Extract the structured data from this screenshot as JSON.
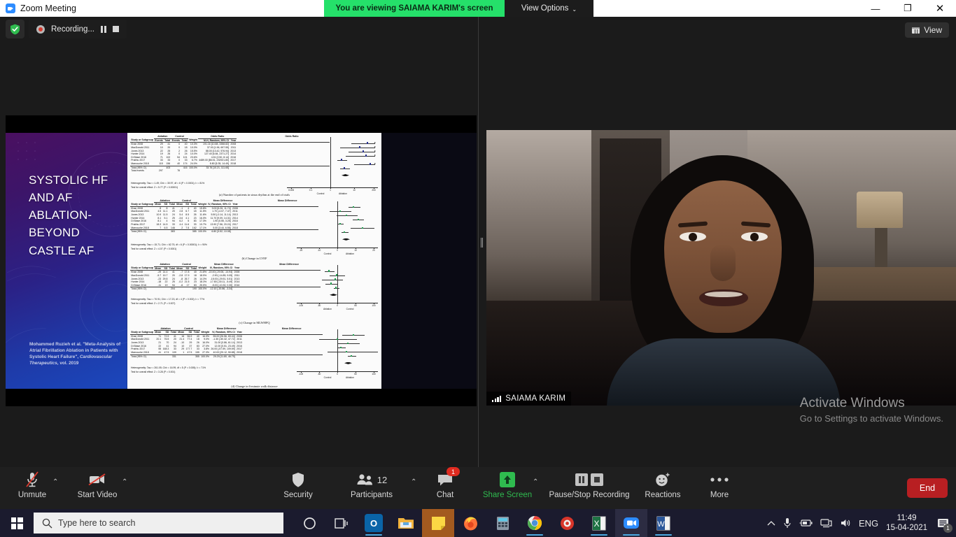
{
  "titlebar": {
    "app_title": "Zoom Meeting",
    "logo_icon": "zoom-logo-icon",
    "share_banner": "You are viewing SAIAMA KARIM's screen",
    "view_options_label": "View Options",
    "view_options_caret": "⌄",
    "minimize": "—",
    "maximize": "❐",
    "close": "✕"
  },
  "recording": {
    "shield_icon": "shield-check-icon",
    "status_text": "Recording...",
    "pause_icon": "pause-icon",
    "stop_icon": "stop-icon"
  },
  "share_pane": {
    "slide": {
      "title": "SYSTOLIC HF AND AF ABLATION- BEYOND CASTLE AF",
      "citation_plain_1": "Mohammed Ruzieh et al. \"Meta-Analysis of Atrial Fibrillation Ablation in Patients with Systolic Heart Failure\", ",
      "citation_italic": "Cardiovascular Therapeutics",
      "citation_plain_2": ", vol. 2019"
    }
  },
  "video_pane": {
    "view_button_label": "View",
    "view_button_icon": "gallery-view-icon",
    "participant_name": "SAIAMA KARIM",
    "signal_icon": "signal-strength-icon"
  },
  "watermark": {
    "line1": "Activate Windows",
    "line2": "Go to Settings to activate Windows."
  },
  "toolbar": {
    "items": [
      {
        "id": "unmute",
        "label": "Unmute",
        "icon": "microphone-muted-icon",
        "caret": "⌃"
      },
      {
        "id": "start-video",
        "label": "Start Video",
        "icon": "video-camera-muted-icon",
        "caret": "⌃"
      },
      {
        "id": "security",
        "label": "Security",
        "icon": "shield-icon"
      },
      {
        "id": "participants",
        "label": "Participants",
        "icon": "people-icon",
        "count": "12",
        "caret": "⌃"
      },
      {
        "id": "chat",
        "label": "Chat",
        "icon": "chat-bubble-icon",
        "badge": "1"
      },
      {
        "id": "share-screen",
        "label": "Share Screen",
        "icon": "share-screen-up-arrow-icon",
        "caret": "⌃"
      },
      {
        "id": "pause-stop-recording",
        "label": "Pause/Stop Recording",
        "icon": "pause-stop-icon"
      },
      {
        "id": "reactions",
        "label": "Reactions",
        "icon": "smiley-reactions-icon"
      },
      {
        "id": "more",
        "label": "More",
        "icon": "ellipsis-icon"
      }
    ],
    "end_label": "End"
  },
  "taskbar": {
    "start_icon": "windows-start-icon",
    "search_placeholder": "Type here to search",
    "search_icon": "search-icon",
    "pinned": [
      {
        "id": "cortana",
        "icon": "cortana-circle-icon",
        "label": "O"
      },
      {
        "id": "task-view",
        "icon": "task-view-icon",
        "label": "目"
      },
      {
        "id": "outlook",
        "icon": "outlook-icon",
        "label": "O"
      },
      {
        "id": "file-explorer",
        "icon": "file-explorer-icon",
        "label": "📁"
      },
      {
        "id": "sticky-notes",
        "icon": "sticky-notes-icon",
        "label": "▧"
      },
      {
        "id": "firefox",
        "icon": "firefox-icon",
        "label": "🦊"
      },
      {
        "id": "calculator",
        "icon": "calculator-icon",
        "label": "▤"
      },
      {
        "id": "chrome",
        "icon": "chrome-icon",
        "label": "◉"
      },
      {
        "id": "app-red",
        "icon": "red-app-icon",
        "label": "◍"
      },
      {
        "id": "excel",
        "icon": "excel-icon",
        "label": "X"
      },
      {
        "id": "zoom",
        "icon": "zoom-icon",
        "label": "▣"
      },
      {
        "id": "word",
        "icon": "word-icon",
        "label": "W"
      }
    ],
    "tray": {
      "chevron_icon": "show-hidden-icons-chevron",
      "mic_icon": "microphone-icon",
      "battery_icon": "battery-icon",
      "network_icon": "network-icon",
      "volume_icon": "volume-icon",
      "language": "ENG",
      "time": "11:49",
      "date": "15-04-2021",
      "notification_icon": "action-center-icon",
      "notification_count": "1"
    }
  },
  "chart_data": [
    {
      "type": "table",
      "id": "forest-a",
      "caption": "(a) Number of patients in sinus rhythm at the end of trials",
      "group_headers": [
        "Ablation",
        "Control",
        "Odds Ratio",
        "Odds Ratio"
      ],
      "columns": [
        "Study or Subgroup",
        "Events",
        "Total",
        "Events",
        "Total",
        "Weight",
        "M-H, Random, 95% CI",
        "Year"
      ],
      "rows": [
        [
          "Khan 2008",
          "29",
          "41",
          "0",
          "40",
          "10.3%",
          "191.16 [10.88, 3358.82]",
          "2008"
        ],
        [
          "MacDonald 2011",
          "10",
          "20",
          "0",
          "18",
          "10.0%",
          "37.00 [1.96, 697.55]",
          "2011"
        ],
        [
          "Jones 2013",
          "22",
          "25",
          "2",
          "26",
          "15.5%",
          "88.00 [13.42, 576.94]",
          "2013"
        ],
        [
          "Hunter 2014",
          "19",
          "26",
          "0",
          "24",
          "10.0%",
          "127.40 [6.84, 2371.27]",
          "2014"
        ],
        [
          "Di Biase 2016",
          "71",
          "102",
          "54",
          "101",
          "23.6%",
          "4.51 [2.50, 8.14]",
          "2016"
        ],
        [
          "Prabhu 2017",
          "33",
          "33",
          "0",
          "33",
          "6.7%",
          "4489.00 [86.51, 232921.80]",
          "2017"
        ],
        [
          "Marrouche 2018",
          "115",
          "156",
          "40",
          "174",
          "24.0%",
          "8.80 [5.35, 14.49]",
          "2018"
        ]
      ],
      "total_row": [
        "Total (95% CI)",
        "",
        "403",
        "",
        "416",
        "100.0%",
        "33.76 [10.21, 111.65]",
        ""
      ],
      "total_events": [
        "Total events",
        "297",
        "",
        "76",
        "",
        "",
        "",
        ""
      ],
      "heterogeneity": "Heterogeneity: Tau² = 1.49; Chi² = 30.97, df = 6 (P < 0.0001); I² = 81%",
      "overall_effect": "Test for overall effect: Z = 5.77 (P < 0.00001)",
      "axis_ticks": [
        "0.005",
        "0.1",
        "1",
        "10",
        "200"
      ],
      "axis_labels": [
        "Control",
        "Ablation"
      ],
      "scale": "log"
    },
    {
      "type": "table",
      "id": "forest-b",
      "caption": "(b) Change in LVEF",
      "group_headers": [
        "Ablation",
        "Control",
        "Mean Difference",
        "Mean Difference"
      ],
      "columns": [
        "Study or Subgroup",
        "Mean",
        "SD",
        "Total",
        "Mean",
        "SD",
        "Total",
        "Weight",
        "IV, Random, 95% CI",
        "Year"
      ],
      "rows": [
        [
          "Khan 2008",
          "8",
          "8",
          "41",
          "-1",
          "4",
          "40",
          "15.8%",
          "9.00 [6.26, 11.74]",
          "2008"
        ],
        [
          "MacDonald 2011",
          "4.5",
          "11.1",
          "20",
          "2.8",
          "6.7",
          "18",
          "11.5%",
          "1.70 [-4.07, 7.47]",
          "2011"
        ],
        [
          "Jones 2013",
          "10.9",
          "11.5",
          "24",
          "5.4",
          "8.5",
          "26",
          "11.6%",
          "5.50 [-0.14, 11.14]",
          "2013"
        ],
        [
          "Hunter 2014",
          "8.1",
          "5.1",
          "25",
          "-3.6",
          "4.1",
          "23",
          "16.0%",
          "11.70 [9.09, 14.31]",
          "2014"
        ],
        [
          "Di Biase 2016",
          "8.1",
          "4",
          "94",
          "6.2",
          "5",
          "83",
          "17.3%",
          "1.90 [0.55, 3.25]",
          "2016"
        ],
        [
          "Prabhu 2017",
          "18.3",
          "14.5",
          "33",
          "4.4",
          "11.6",
          "33",
          "10.7%",
          "13.90 [7.56, 20.24]",
          "2017"
        ],
        [
          "Marrouche 2018",
          "7",
          "6.5",
          "146",
          "2",
          "7.5",
          "162",
          "17.1%",
          "5.00 [3.44, 6.56]",
          "2018"
        ]
      ],
      "total_row": [
        "Total (95% CI)",
        "",
        "",
        "383",
        "",
        "",
        "385",
        "100.0%",
        "6.80 [3.52, 10.08]",
        ""
      ],
      "heterogeneity": "Heterogeneity: Tau² = 15.71; Chi² = 62.75, df = 6 (P < 0.00001); I² = 90%",
      "overall_effect": "Test for overall effect: Z = 4.07 (P < 0.0001)",
      "axis_ticks": [
        "-20",
        "-10",
        "0",
        "10",
        "20"
      ],
      "axis_labels": [
        "Control",
        "Ablation"
      ],
      "scale": "linear"
    },
    {
      "type": "table",
      "id": "forest-c",
      "caption": "(c) Change in MLWHFQ",
      "group_headers": [
        "Ablation",
        "Control",
        "Mean Difference",
        "Mean Difference"
      ],
      "columns": [
        "Study or Subgroup",
        "Mean",
        "SD",
        "Total",
        "Mean",
        "SD",
        "Total",
        "Weight",
        "IV, Random, 95% CI",
        "Year"
      ],
      "rows": [
        [
          "Khan 2008",
          "-29",
          "14.4",
          "41",
          "-7",
          "17.8",
          "40",
          "21.8%",
          "-22.00 [-29.06, -14.94]",
          "2008"
        ],
        [
          "MacDonald 2011",
          "-5.7",
          "19.7",
          "20",
          "-2.8",
          "17.9",
          "18",
          "18.5%",
          "-2.90 [-14.85, 9.05]",
          "2011"
        ],
        [
          "Jones 2013",
          "-23",
          "29.8",
          "24",
          "-8",
          "26.7",
          "26",
          "14.3%",
          "-15.00 [-29.51, 5.51]",
          "2013"
        ],
        [
          "Hunter 2014",
          "-18",
          "22",
          "25",
          "-0.2",
          "21.5",
          "23",
          "18.3%",
          "-17.80 [-30.11, -5.49]",
          "2014"
        ],
        [
          "Di Biase 2016",
          "-11",
          "19",
          "94",
          "-6",
          "17",
          "83",
          "25.5%",
          "-5.00 [-10.30, 0.30]",
          "2016"
        ]
      ],
      "total_row": [
        "Total (95% CI)",
        "",
        "",
        "204",
        "",
        "",
        "190",
        "100.0%",
        "-12.10 [-20.86, -3.34]",
        ""
      ],
      "heterogeneity": "Heterogeneity: Tau² = 70.91; Chi² = 17.23, df = 4 (P = 0.002); I² = 77%",
      "overall_effect": "Test for overall effect: Z = 2.71 (P = 0.007)",
      "axis_ticks": [
        "-100",
        "-50",
        "0",
        "50",
        "100"
      ],
      "axis_labels": [
        "Ablation",
        "Control"
      ],
      "scale": "linear"
    },
    {
      "type": "table",
      "id": "forest-d",
      "caption": "(d) Change in 6-minute walk distance",
      "group_headers": [
        "Ablation",
        "Control",
        "Mean Difference",
        "Mean Difference"
      ],
      "columns": [
        "Study or Subgroup",
        "Mean",
        "SD",
        "Total",
        "Mean",
        "SD",
        "Total",
        "Weight",
        "IV, Random, 95% CI",
        "Year"
      ],
      "rows": [
        [
          "Khan 2008",
          "71",
          "72.9",
          "41",
          "16",
          "56.9",
          "40",
          "16.9%",
          "55.00 [26.56, 83.44]",
          "2008"
        ],
        [
          "MacDonald 2011",
          "20.1",
          "76.5",
          "20",
          "21.4",
          "77.4",
          "18",
          "9.0%",
          "-1.30 [-50.32, 47.72]",
          "2011"
        ],
        [
          "Jones 2013",
          "21",
          "70",
          "24",
          "-10",
          "29",
          "26",
          "16.0%",
          "31.00 [0.86, 61.14]",
          "2013"
        ],
        [
          "Di Biase 2016",
          "22",
          "41",
          "94",
          "10",
          "37",
          "83",
          "27.0%",
          "12.00 [0.51, 23.49]",
          "2016"
        ],
        [
          "Prabhu 2017",
          "55",
          "168.3",
          "33",
          "29",
          "177.7",
          "33",
          "3.8%",
          "26.00 [-57.59, 109.59]",
          "2017"
        ],
        [
          "Marrouche 2018",
          "41",
          "47.5",
          "109",
          "1",
          "47.5",
          "155",
          "27.3%",
          "40.00 [29.12, 50.88]",
          "2018"
        ]
      ],
      "total_row": [
        "Total (95% CI)",
        "",
        "",
        "331",
        "",
        "",
        "355",
        "100.0%",
        "29.29 [11.80, 46.79]",
        ""
      ],
      "heterogeneity": "Heterogeneity: Tau² = 261.05; Chi² = 16.99, df = 5 (P = 0.005); I² = 71%",
      "overall_effect": "Test for overall effect: Z = 3.28 (P = 0.001)",
      "axis_ticks": [
        "-100",
        "-50",
        "0",
        "50",
        "100"
      ],
      "axis_labels": [
        "Control",
        "Ablation"
      ],
      "scale": "linear"
    }
  ]
}
